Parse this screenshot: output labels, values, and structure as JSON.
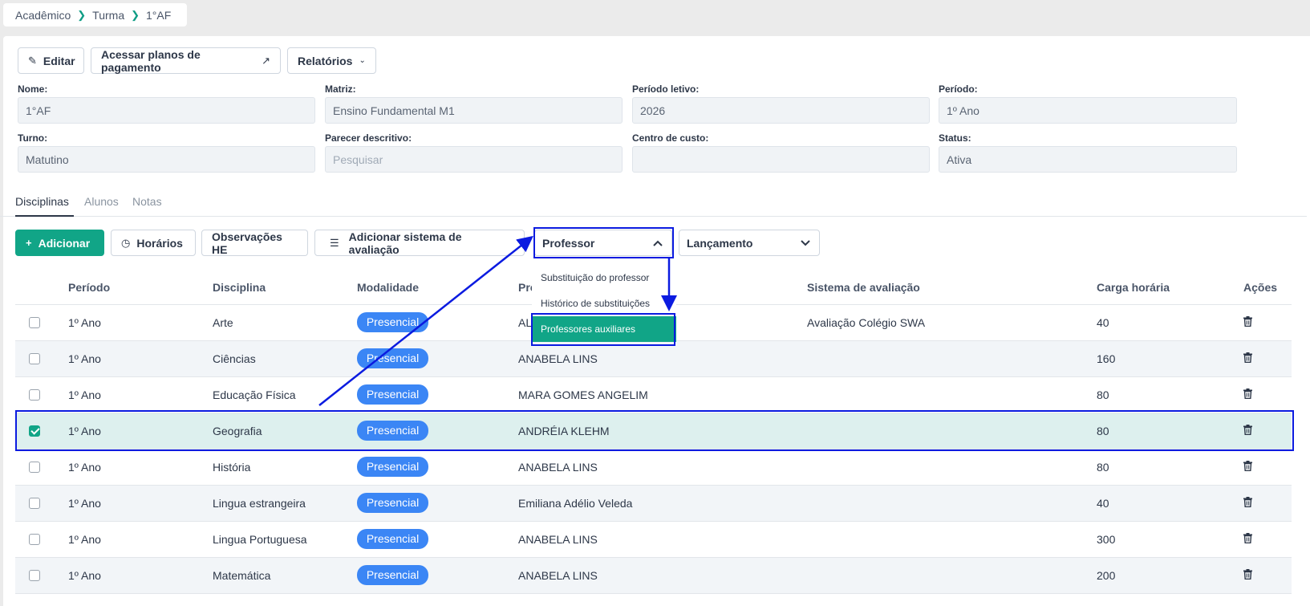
{
  "breadcrumb": [
    "Acadêmico",
    "Turma",
    "1°AF"
  ],
  "toolbar": {
    "edit": "Editar",
    "payment_plans": "Acessar planos de pagamento",
    "reports": "Relatórios"
  },
  "fields": [
    {
      "label": "Nome:",
      "value": "1°AF"
    },
    {
      "label": "Matriz:",
      "value": "Ensino Fundamental M1"
    },
    {
      "label": "Período letivo:",
      "value": "2026"
    },
    {
      "label": "Período:",
      "value": "1º Ano"
    },
    {
      "label": "Turno:",
      "value": "Matutino"
    },
    {
      "label": "Parecer descritivo:",
      "placeholder": "Pesquisar"
    },
    {
      "label": "Centro de custo:",
      "value": ""
    },
    {
      "label": "Status:",
      "value": "Ativa"
    }
  ],
  "tabs": [
    "Disciplinas",
    "Alunos",
    "Notas"
  ],
  "actions": {
    "add": "Adicionar",
    "schedule": "Horários",
    "notes": "Observações HE",
    "add_eval": "Adicionar sistema de avaliação",
    "professor": "Professor",
    "launch": "Lançamento"
  },
  "professor_menu": [
    "Substituição do professor",
    "Histórico de substituições",
    "Professores auxiliares"
  ],
  "table": {
    "headers": [
      "Período",
      "Disciplina",
      "Modalidade",
      "Pro",
      "Sistema de avaliação",
      "Carga horária",
      "Ações"
    ],
    "rows": [
      {
        "checked": false,
        "period": "1º Ano",
        "subject": "Arte",
        "mode": "Presencial",
        "teacher": "AL",
        "eval": "Avaliação Colégio SWA",
        "hours": "40"
      },
      {
        "checked": false,
        "period": "1º Ano",
        "subject": "Ciências",
        "mode": "Presencial",
        "teacher": "ANABELA LINS",
        "eval": "",
        "hours": "160"
      },
      {
        "checked": false,
        "period": "1º Ano",
        "subject": "Educação Física",
        "mode": "Presencial",
        "teacher": "MARA GOMES ANGELIM",
        "eval": "",
        "hours": "80"
      },
      {
        "checked": true,
        "period": "1º Ano",
        "subject": "Geografia",
        "mode": "Presencial",
        "teacher": "ANDRÉIA KLEHM",
        "eval": "",
        "hours": "80"
      },
      {
        "checked": false,
        "period": "1º Ano",
        "subject": "História",
        "mode": "Presencial",
        "teacher": "ANABELA LINS",
        "eval": "",
        "hours": "80"
      },
      {
        "checked": false,
        "period": "1º Ano",
        "subject": "Lingua estrangeira",
        "mode": "Presencial",
        "teacher": "Emiliana Adélio Veleda",
        "eval": "",
        "hours": "40"
      },
      {
        "checked": false,
        "period": "1º Ano",
        "subject": "Lingua Portuguesa",
        "mode": "Presencial",
        "teacher": "ANABELA LINS",
        "eval": "",
        "hours": "300"
      },
      {
        "checked": false,
        "period": "1º Ano",
        "subject": "Matemática",
        "mode": "Presencial",
        "teacher": "ANABELA LINS",
        "eval": "",
        "hours": "200"
      }
    ]
  },
  "colors": {
    "accent": "#11a587",
    "pill": "#3b86f5",
    "annotation": "#0b1be0",
    "selected_row": "#ddf0ee"
  }
}
